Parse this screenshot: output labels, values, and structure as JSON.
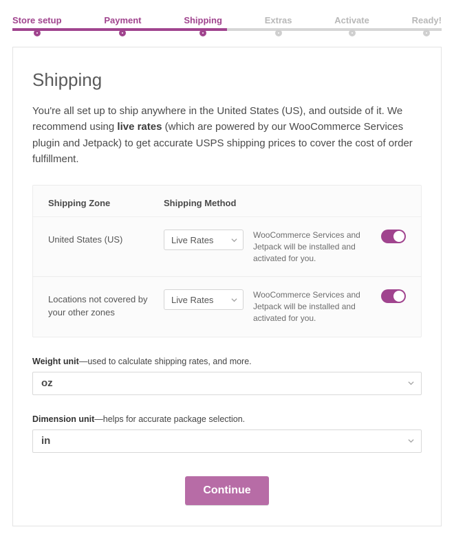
{
  "colors": {
    "brand": "#a0448e"
  },
  "stepper": {
    "steps": [
      {
        "label": "Store setup",
        "state": "done"
      },
      {
        "label": "Payment",
        "state": "done"
      },
      {
        "label": "Shipping",
        "state": "current"
      },
      {
        "label": "Extras",
        "state": "future"
      },
      {
        "label": "Activate",
        "state": "future"
      },
      {
        "label": "Ready!",
        "state": "future"
      }
    ],
    "fill_percent": 50
  },
  "heading": "Shipping",
  "intro": {
    "pre": "You're all set up to ship anywhere in the United States (US), and outside of it. We recommend using ",
    "bold": "live rates",
    "post": " (which are powered by our WooCommerce Services plugin and Jetpack) to get accurate USPS shipping prices to cover the cost of order fulfillment."
  },
  "zone_table": {
    "header_zone": "Shipping Zone",
    "header_method": "Shipping Method",
    "rows": [
      {
        "zone": "United States (US)",
        "method": "Live Rates",
        "desc": "WooCommerce Services and Jetpack will be installed and activated for you.",
        "enabled": true
      },
      {
        "zone": "Locations not covered by your other zones",
        "method": "Live Rates",
        "desc": "WooCommerce Services and Jetpack will be installed and activated for you.",
        "enabled": true
      }
    ]
  },
  "weight_unit": {
    "label_bold": "Weight unit",
    "label_rest": "—used to calculate shipping rates, and more.",
    "value": "oz"
  },
  "dimension_unit": {
    "label_bold": "Dimension unit",
    "label_rest": "—helps for accurate package selection.",
    "value": "in"
  },
  "continue_label": "Continue"
}
